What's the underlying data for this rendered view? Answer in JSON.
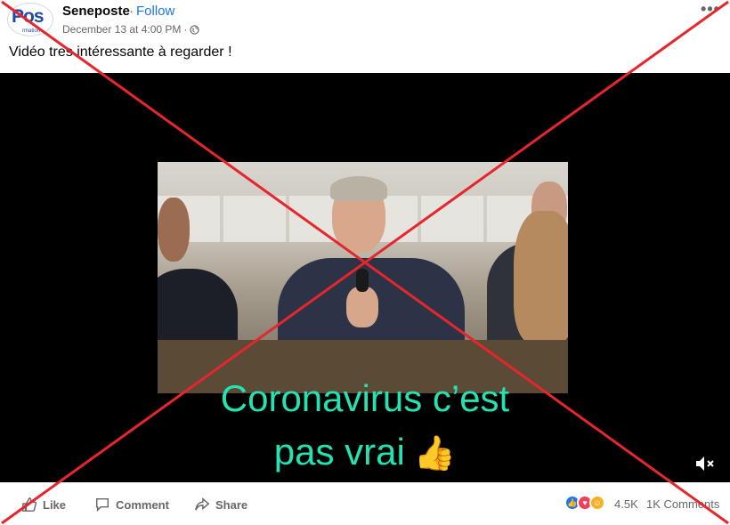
{
  "post": {
    "avatar_logo_text": "Pos",
    "avatar_logo_sub": "rmation",
    "page_name": "Seneposte",
    "separator": "·",
    "follow_label": "Follow",
    "timestamp": "December 13 at 4:00 PM",
    "meta_separator": "·",
    "caption": "Vidéo tres intéressante à regarder !"
  },
  "video": {
    "overlay_line1": "Coronavirus c’est",
    "overlay_line2": "pas vrai",
    "overlay_emoji": "👍",
    "overlay_text_color": "#25e2b2"
  },
  "actions": {
    "like_label": "Like",
    "comment_label": "Comment",
    "share_label": "Share"
  },
  "stats": {
    "reaction_count": "4.5K",
    "comment_count": "1K Comments",
    "reaction_icons": [
      "like-icon",
      "love-icon",
      "care-icon"
    ]
  },
  "colors": {
    "accent": "#1877f2",
    "cross": "#e5262c",
    "muted_text": "#65676b"
  }
}
